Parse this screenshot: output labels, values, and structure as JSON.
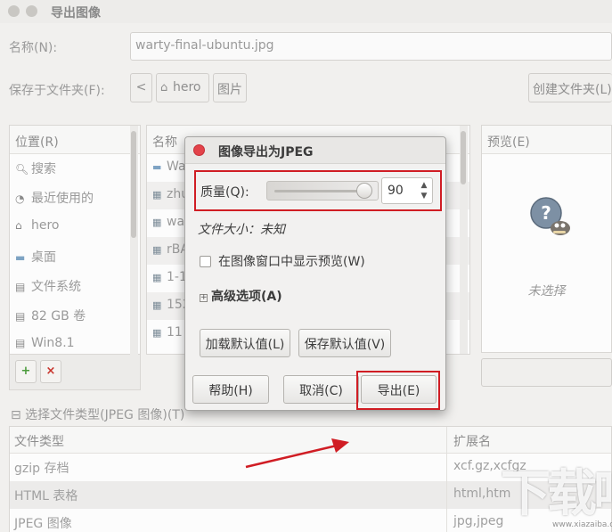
{
  "window": {
    "title": "导出图像"
  },
  "name_field": {
    "label": "名称(N):",
    "value": "warty-final-ubuntu.jpg"
  },
  "folder": {
    "label": "保存于文件夹(F):",
    "path_back": "<",
    "path_home": "hero",
    "path_current": "图片",
    "create_folder": "创建文件夹(L)"
  },
  "places": {
    "header": "位置(R)",
    "items": [
      {
        "icon": "search-icon",
        "label": "搜索"
      },
      {
        "icon": "recent-icon",
        "label": "最近使用的"
      },
      {
        "icon": "home-icon",
        "label": "hero"
      },
      {
        "icon": "folder-icon",
        "label": "桌面"
      },
      {
        "icon": "drive-icon",
        "label": "文件系统"
      },
      {
        "icon": "drive-icon",
        "label": "82 GB 卷"
      },
      {
        "icon": "drive-icon",
        "label": "Win8.1"
      }
    ],
    "add_label": "+",
    "remove_label": "×"
  },
  "files": {
    "header": "名称",
    "rows": [
      "Wa",
      "zhu",
      "wa",
      "rBA",
      "1-1",
      "152",
      "11"
    ]
  },
  "preview": {
    "header": "预览(E)",
    "none_label": "未选择"
  },
  "filetype": {
    "toggle_label": "⊟ 选择文件类型(JPEG 图像)(T)",
    "col_type": "文件类型",
    "col_ext": "扩展名",
    "rows": [
      {
        "type": "gzip 存档",
        "ext": "xcf.gz,xcfgz"
      },
      {
        "type": "HTML 表格",
        "ext": "html,htm"
      },
      {
        "type": "JPEG 图像",
        "ext": "jpg,jpeg"
      }
    ]
  },
  "jpeg_dialog": {
    "title": "图像导出为JPEG",
    "quality_label": "质量(Q):",
    "quality_value": "90",
    "quality_slider_fraction": 0.9,
    "file_size": "文件大小：未知",
    "show_preview_label": "在图像窗口中显示预览(W)",
    "show_preview_checked": false,
    "advanced_label": "高级选项(A)",
    "load_defaults": "加载默认值(L)",
    "save_defaults": "保存默认值(V)",
    "help": "帮助(H)",
    "cancel": "取消(C)",
    "export": "导出(E)"
  },
  "watermark": {
    "text": "下载吧",
    "sub": "www.xiazaiba.com"
  },
  "colors": {
    "highlight_red": "#d01d24",
    "close_red": "#e3434a"
  }
}
